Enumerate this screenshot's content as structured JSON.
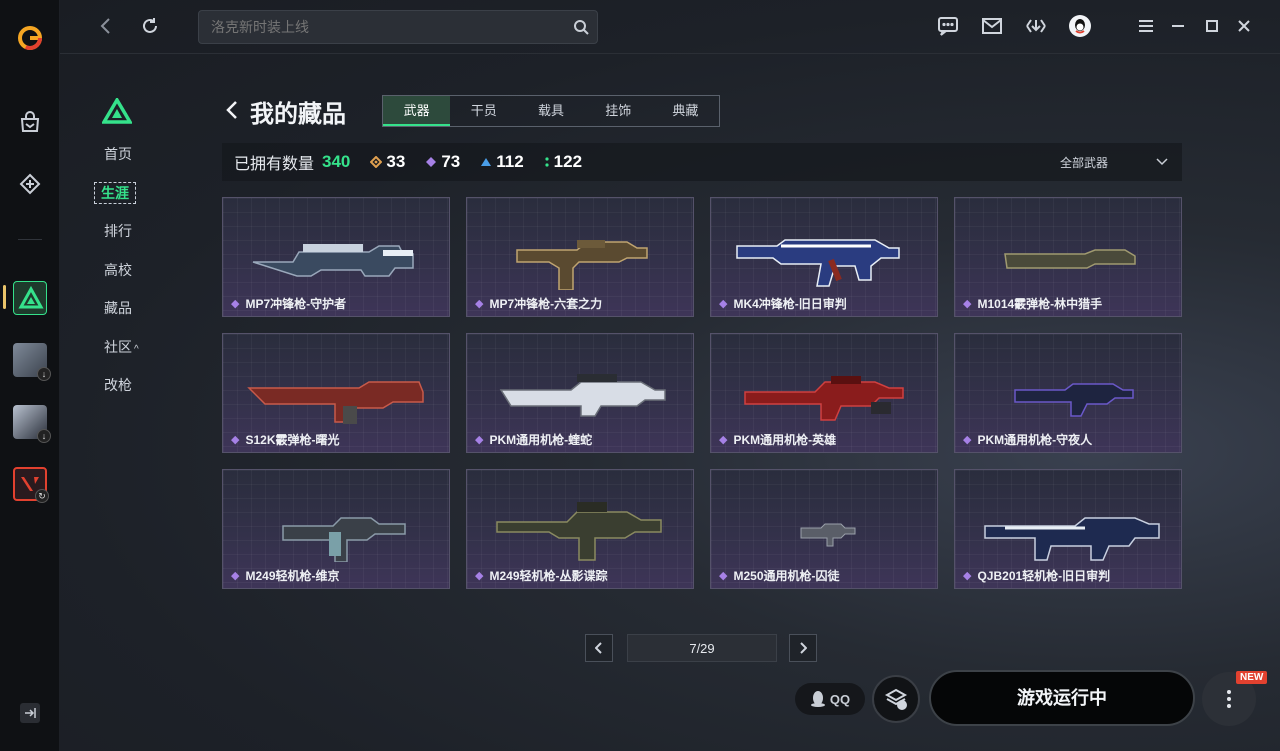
{
  "search": {
    "placeholder": "洛克新时装上线"
  },
  "nav": {
    "items": [
      {
        "label": "首页"
      },
      {
        "label": "生涯"
      },
      {
        "label": "排行"
      },
      {
        "label": "高校"
      },
      {
        "label": "藏品"
      },
      {
        "label": "社区"
      },
      {
        "label": "改枪"
      }
    ],
    "community_caret": "^"
  },
  "header": {
    "title": "我的藏品"
  },
  "tabs": [
    {
      "label": "武器",
      "active": true
    },
    {
      "label": "干员"
    },
    {
      "label": "载具"
    },
    {
      "label": "挂饰"
    },
    {
      "label": "典藏"
    }
  ],
  "stats": {
    "owned_label": "已拥有数量",
    "owned_total": "340",
    "groups": [
      {
        "icon": "gold-diamond-icon",
        "color": "#e0a050",
        "value": "33"
      },
      {
        "icon": "purple-diamond-icon",
        "color": "#a681e6",
        "value": "73"
      },
      {
        "icon": "blue-triangle-icon",
        "color": "#4a9ee8",
        "value": "112"
      },
      {
        "icon": "green-dots-icon",
        "color": "#35e28b",
        "value": "122"
      }
    ],
    "filter_label": "全部武器"
  },
  "items": [
    {
      "name": "MP7冲锋枪-守护者"
    },
    {
      "name": "MP7冲锋枪-六套之力"
    },
    {
      "name": "MK4冲锋枪-旧日审判"
    },
    {
      "name": "M1014霰弹枪-林中猎手"
    },
    {
      "name": "S12K霰弹枪-曙光"
    },
    {
      "name": "PKM通用机枪-蝰蛇"
    },
    {
      "name": "PKM通用机枪-英雄"
    },
    {
      "name": "PKM通用机枪-守夜人"
    },
    {
      "name": "M249轻机枪-维京"
    },
    {
      "name": "M249轻机枪-丛影谍踪"
    },
    {
      "name": "M250通用机枪-囚徒"
    },
    {
      "name": "QJB201轻机枪-旧日审判"
    }
  ],
  "pagination": {
    "label": "7/29"
  },
  "bottom": {
    "qq_label": "QQ",
    "play_label": "游戏运行中",
    "new_badge": "NEW"
  },
  "colors": {
    "accent": "#35e28b",
    "rare_purple": "#a681e6"
  }
}
